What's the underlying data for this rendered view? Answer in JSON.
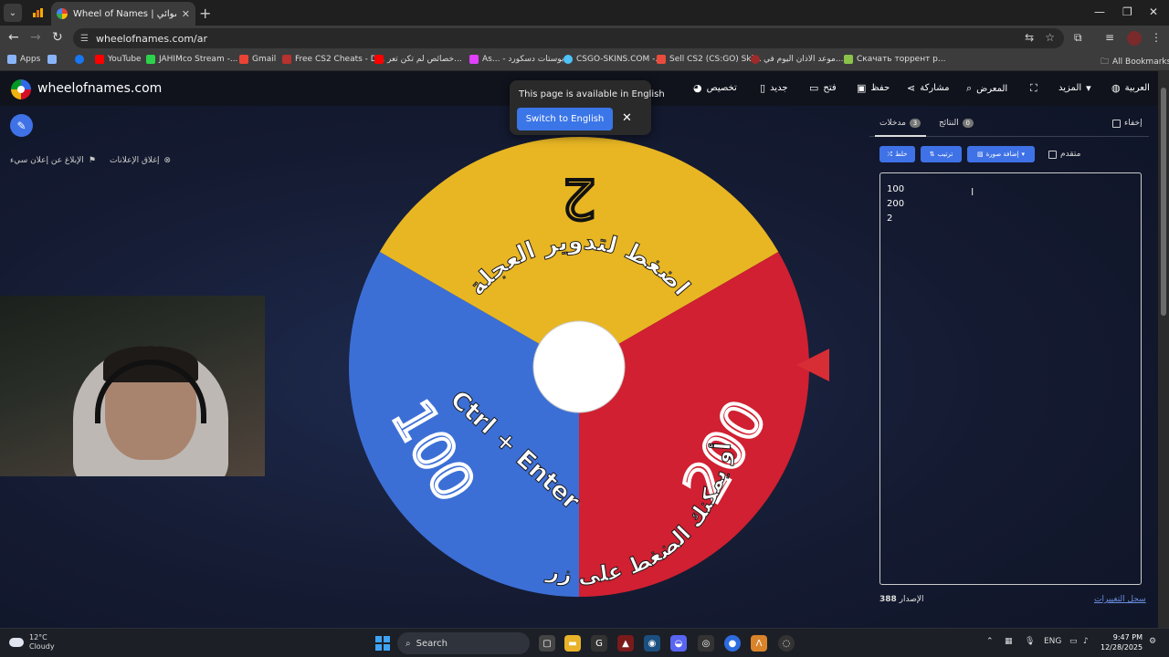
{
  "browser": {
    "tab_title": "Wheel of Names | اسم العشوائي",
    "url": "wheelofnames.com/ar",
    "bookmarks": [
      {
        "label": "Apps",
        "color": "#8ab4f8"
      },
      {
        "label": "",
        "color": "#8ab4f8"
      },
      {
        "label": "",
        "color": "#1877f2"
      },
      {
        "label": "YouTube",
        "color": "#ff0000"
      },
      {
        "label": "JAHIMco Stream -...",
        "color": "#2dd24b"
      },
      {
        "label": "Gmail",
        "color": "#ea4335"
      },
      {
        "label": "Free CS2 Cheats - D...",
        "color": "#b8322f"
      },
      {
        "label": "خصائص لم تكن تعر...",
        "color": "#ff0000"
      },
      {
        "label": "As... - بوستات دسكورد",
        "color": "#e040fb"
      },
      {
        "label": "CSGO-SKINS.COM -...",
        "color": "#4fc3f7"
      },
      {
        "label": "Sell CS2 (CS:GO) Ski...",
        "color": "#e94b3c"
      },
      {
        "label": "موعد الاذان اليوم في...",
        "color": "#9e2a2a"
      },
      {
        "label": "Скачать торрент р...",
        "color": "#8bc34a"
      }
    ],
    "all_bookmarks": "All Bookmarks"
  },
  "site": {
    "title": "wheelofnames.com",
    "nav": {
      "customize": "تخصيص",
      "new": "جديد",
      "open": "فتح",
      "save": "حفظ",
      "share": "مشاركة",
      "gallery": "المعرض",
      "more": "المزيد",
      "language": "العربية"
    },
    "ads": {
      "close_ads": "إغلاق الإعلانات",
      "report_ad": "الإبلاغ عن إعلان سيء"
    }
  },
  "translate_popup": {
    "message": "This page is available in English",
    "button": "Switch to English"
  },
  "wheel": {
    "segments": [
      {
        "label": "2",
        "color": "#e8b623"
      },
      {
        "label": "200",
        "color": "#d02031"
      },
      {
        "label": "100",
        "color": "#3c6fd6"
      }
    ],
    "instruction_top": "اضغط لتدوير العجلة",
    "instruction_bottom": "أو يمكنك الضغط على زر",
    "shortcut": "Ctrl + Enter"
  },
  "panel": {
    "tabs": {
      "entries_label": "مدخلات",
      "entries_count": "3",
      "results_label": "النتائج",
      "results_count": "0",
      "hide_label": "إخفاء"
    },
    "tools": {
      "shuffle": "خلط",
      "sort": "ترتيب",
      "add_image": "إضافة صورة",
      "advanced": "متقدم"
    },
    "entries": [
      "100",
      "200",
      "2"
    ],
    "version_label": "الإصدار",
    "version_number": "388",
    "changelog": "سجل التغييرات"
  },
  "taskbar": {
    "temperature": "12°C",
    "condition": "Cloudy",
    "search": "Search",
    "language": "ENG",
    "time": "9:47 PM",
    "date": "12/28/2025"
  }
}
